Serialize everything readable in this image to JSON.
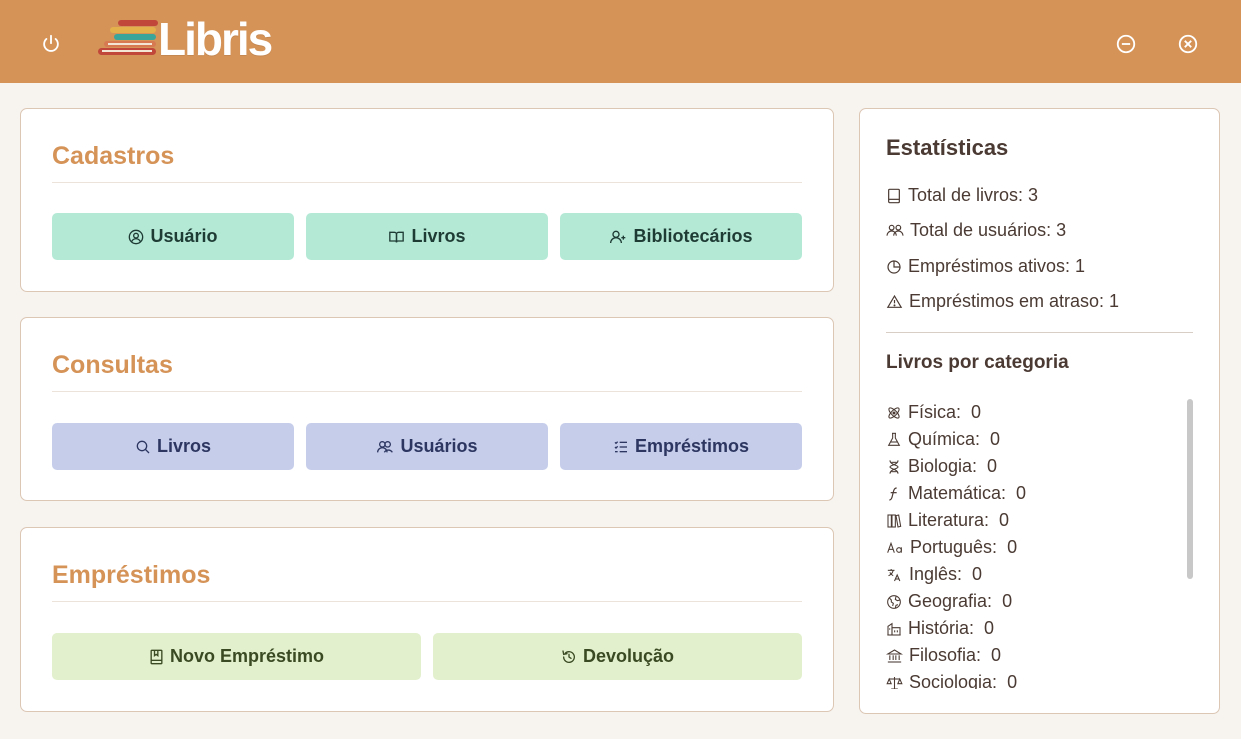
{
  "header": {
    "logo_text": "Libris",
    "power_icon": "power-icon",
    "minimize_icon": "minimize-icon",
    "close_icon": "close-icon"
  },
  "colors": {
    "topbar": "#d59357",
    "accent_title": "#d59357",
    "cadastros_button": "#b4e9d6",
    "consultas_button": "#c6cdeb",
    "emprestimos_button": "#e3f0cd"
  },
  "cadastros": {
    "title": "Cadastros",
    "buttons": [
      {
        "label": "Usuário",
        "icon": "user-circle-icon"
      },
      {
        "label": "Livros",
        "icon": "book-open-icon"
      },
      {
        "label": "Bibliotecários",
        "icon": "user-plus-icon"
      }
    ]
  },
  "consultas": {
    "title": "Consultas",
    "buttons": [
      {
        "label": "Livros",
        "icon": "search-icon"
      },
      {
        "label": "Usuários",
        "icon": "users-icon"
      },
      {
        "label": "Empréstimos",
        "icon": "checklist-icon"
      }
    ]
  },
  "emprestimos": {
    "title": "Empréstimos",
    "buttons": [
      {
        "label": "Novo Empréstimo",
        "icon": "bookmark-book-icon"
      },
      {
        "label": "Devolução",
        "icon": "undo-icon"
      }
    ]
  },
  "stats": {
    "title": "Estatísticas",
    "lines": [
      {
        "text": "Total de livros: 3",
        "icon": "book-icon"
      },
      {
        "text": "Total de usuários: 3",
        "icon": "users-icon"
      },
      {
        "text": "Empréstimos ativos: 1",
        "icon": "clock-pie-icon"
      },
      {
        "text": "Empréstimos em atraso: 1",
        "icon": "warning-icon"
      }
    ],
    "category_title": "Livros por categoria",
    "categories": [
      {
        "name": "Física:",
        "count": "0",
        "icon": "atom-icon"
      },
      {
        "name": "Química:",
        "count": "0",
        "icon": "flask-icon"
      },
      {
        "name": "Biologia:",
        "count": "0",
        "icon": "dna-icon"
      },
      {
        "name": "Matemática:",
        "count": "0",
        "icon": "function-icon"
      },
      {
        "name": "Literatura:",
        "count": "0",
        "icon": "books-icon"
      },
      {
        "name": "Português:",
        "count": "0",
        "icon": "text-aa-icon"
      },
      {
        "name": "Inglês:",
        "count": "0",
        "icon": "translate-icon"
      },
      {
        "name": "Geografia:",
        "count": "0",
        "icon": "globe-icon"
      },
      {
        "name": "História:",
        "count": "0",
        "icon": "building-icon"
      },
      {
        "name": "Filosofia:",
        "count": "0",
        "icon": "bank-icon"
      },
      {
        "name": "Sociologia:",
        "count": "0",
        "icon": "scale-icon"
      }
    ]
  }
}
